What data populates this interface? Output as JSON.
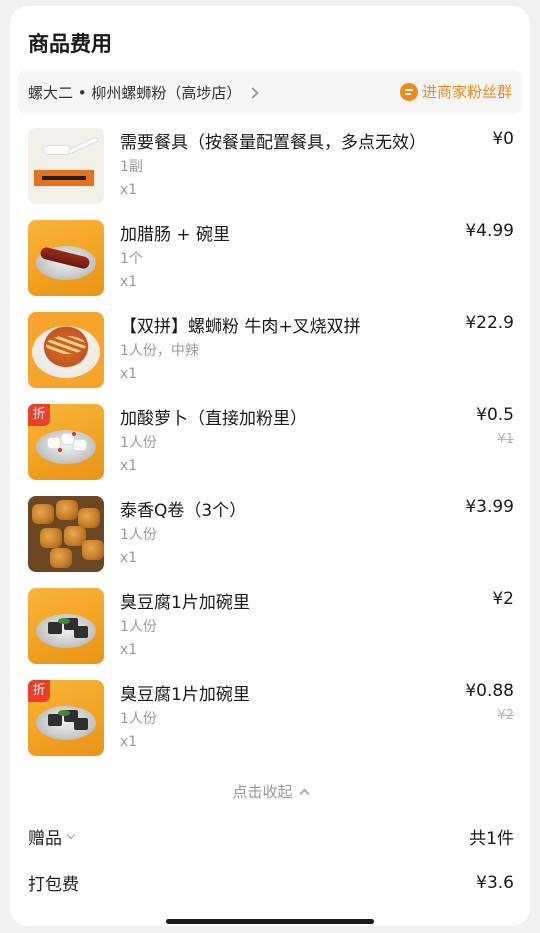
{
  "section_title": "商品费用",
  "store": {
    "name": "螺大二 • 柳州螺蛳粉（高埗店）",
    "fan_group_label": "进商家粉丝群"
  },
  "items": [
    {
      "name": "需要餐具（按餐量配置餐具，多点无效）",
      "spec": "1副",
      "qty": "x1",
      "price": "¥0",
      "original_price": "",
      "discount_badge": "",
      "image": "tableware"
    },
    {
      "name": "加腊肠 + 碗里",
      "spec": "1个",
      "qty": "x1",
      "price": "¥4.99",
      "original_price": "",
      "discount_badge": "",
      "image": "sausage"
    },
    {
      "name": "【双拼】螺蛳粉 牛肉+叉烧双拼",
      "spec": "1人份，中辣",
      "qty": "x1",
      "price": "¥22.9",
      "original_price": "",
      "discount_badge": "",
      "image": "noodle-bowl"
    },
    {
      "name": "加酸萝卜（直接加粉里）",
      "spec": "1人份",
      "qty": "x1",
      "price": "¥0.5",
      "original_price": "¥1",
      "discount_badge": "折",
      "image": "radish"
    },
    {
      "name": "泰香Q卷（3个）",
      "spec": "1人份",
      "qty": "x1",
      "price": "¥3.99",
      "original_price": "",
      "discount_badge": "",
      "image": "q-rolls"
    },
    {
      "name": "臭豆腐1片加碗里",
      "spec": "1人份",
      "qty": "x1",
      "price": "¥2",
      "original_price": "",
      "discount_badge": "",
      "image": "stinky-tofu"
    },
    {
      "name": "臭豆腐1片加碗里",
      "spec": "1人份",
      "qty": "x1",
      "price": "¥0.88",
      "original_price": "¥2",
      "discount_badge": "折",
      "image": "stinky-tofu"
    }
  ],
  "collapse_label": "点击收起",
  "gift": {
    "label": "赠品",
    "value": "共1件"
  },
  "packing_fee": {
    "label": "打包费",
    "value": "¥3.6"
  },
  "colors": {
    "accent": "#f28a1a",
    "discount": "#ee3d2b",
    "thumb_orange": "#f4a322"
  }
}
